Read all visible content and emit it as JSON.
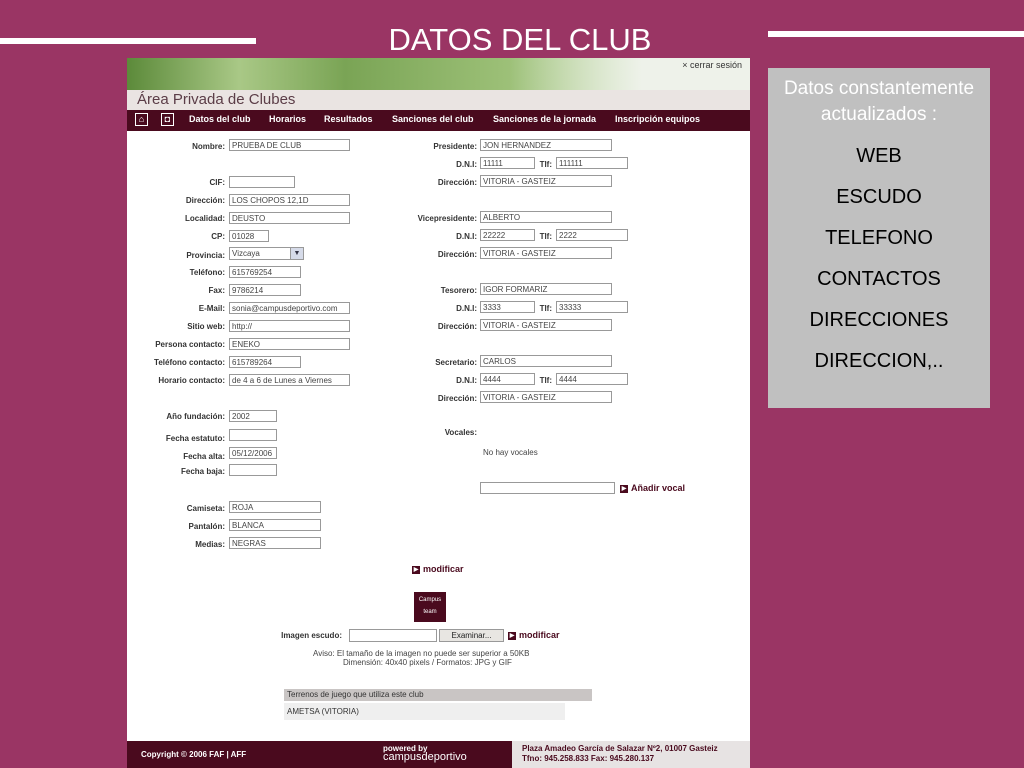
{
  "slide": {
    "title": "DATOS DEL CLUB",
    "sidebar": {
      "heading": "Datos constantemente actualizados :",
      "items": [
        "WEB",
        "ESCUDO",
        "TELEFONO",
        "CONTACTOS",
        "DIRECCIONES",
        "DIRECCION,.."
      ]
    }
  },
  "app": {
    "logout_label": "× cerrar sesión",
    "area_title": "Área Privada de Clubes",
    "nav": {
      "icons": [
        "home-icon",
        "camera-icon"
      ],
      "items": [
        "Datos del club",
        "Horarios",
        "Resultados",
        "Sanciones del club",
        "Sanciones de la jornada",
        "Inscripción equipos"
      ]
    },
    "club": {
      "nombre": {
        "label": "Nombre:",
        "value": "PRUEBA DE CLUB"
      },
      "cif": {
        "label": "CIF:",
        "value": ""
      },
      "direccion": {
        "label": "Dirección:",
        "value": "LOS CHOPOS 12,1D"
      },
      "localidad": {
        "label": "Localidad:",
        "value": "DEUSTO"
      },
      "cp": {
        "label": "CP:",
        "value": "01028"
      },
      "provincia": {
        "label": "Provincia:",
        "value": "Vizcaya"
      },
      "telefono": {
        "label": "Teléfono:",
        "value": "615769254"
      },
      "fax": {
        "label": "Fax:",
        "value": "9786214"
      },
      "email": {
        "label": "E-Mail:",
        "value": "sonia@campusdeportivo.com"
      },
      "web": {
        "label": "Sitio web:",
        "value": "http://"
      },
      "persona_contacto": {
        "label": "Persona contacto:",
        "value": "ENEKO"
      },
      "telefono_contacto": {
        "label": "Teléfono contacto:",
        "value": "615789264"
      },
      "horario_contacto": {
        "label": "Horario contacto:",
        "value": "de 4 a 6 de Lunes a Viernes"
      },
      "ano_fundacion": {
        "label": "Año fundación:",
        "value": "2002"
      },
      "fecha_estatuto": {
        "label": "Fecha estatuto:",
        "value": ""
      },
      "fecha_alta": {
        "label": "Fecha alta:",
        "value": "05/12/2006"
      },
      "fecha_baja": {
        "label": "Fecha baja:",
        "value": ""
      },
      "camiseta": {
        "label": "Camiseta:",
        "value": "ROJA"
      },
      "pantalon": {
        "label": "Pantalón:",
        "value": "BLANCA"
      },
      "medias": {
        "label": "Medias:",
        "value": "NEGRAS"
      }
    },
    "board": {
      "dni_label": "D.N.I:",
      "tlf_label": "Tlf:",
      "dir_label": "Dirección:",
      "presidente": {
        "label": "Presidente:",
        "name": "JON HERNANDEZ",
        "dni": "11111",
        "tlf": "111111",
        "direccion": "VITORIA - GASTEIZ"
      },
      "vicepresidente": {
        "label": "Vicepresidente:",
        "name": "ALBERTO",
        "dni": "22222",
        "tlf": "2222",
        "direccion": "VITORIA - GASTEIZ"
      },
      "tesorero": {
        "label": "Tesorero:",
        "name": "IGOR FORMARIZ",
        "dni": "3333",
        "tlf": "33333",
        "direccion": "VITORIA - GASTEIZ"
      },
      "secretario": {
        "label": "Secretario:",
        "name": "CARLOS",
        "dni": "4444",
        "tlf": "4444",
        "direccion": "VITORIA - GASTEIZ"
      },
      "vocales_label": "Vocales:",
      "no_vocales": "No hay vocales",
      "vocal_input": "",
      "add_vocal": "Añadir vocal"
    },
    "modificar": "modificar",
    "crest_text": [
      "Campus",
      "team"
    ],
    "escudo": {
      "label": "Imagen escudo:",
      "value": "",
      "browse": "Examinar...",
      "modificar": "modificar",
      "notice1": "Aviso: El tamaño de la imagen no puede ser superior a 50KB",
      "notice2": "Dimensión: 40x40 pixels / Formatos: JPG y GIF"
    },
    "terrenos": {
      "header": "Terrenos de juego que utiliza este club",
      "rows": [
        "AMETSA (VITORIA)"
      ]
    },
    "footer": {
      "copyright": "Copyright © 2006 FAF | AFF",
      "powered_by": "powered by",
      "brand": "campusdeportivo",
      "address": "Plaza Amadeo García de Salazar Nº2, 01007 Gasteiz",
      "contact": "Tfno: 945.258.833 Fax: 945.280.137"
    }
  }
}
